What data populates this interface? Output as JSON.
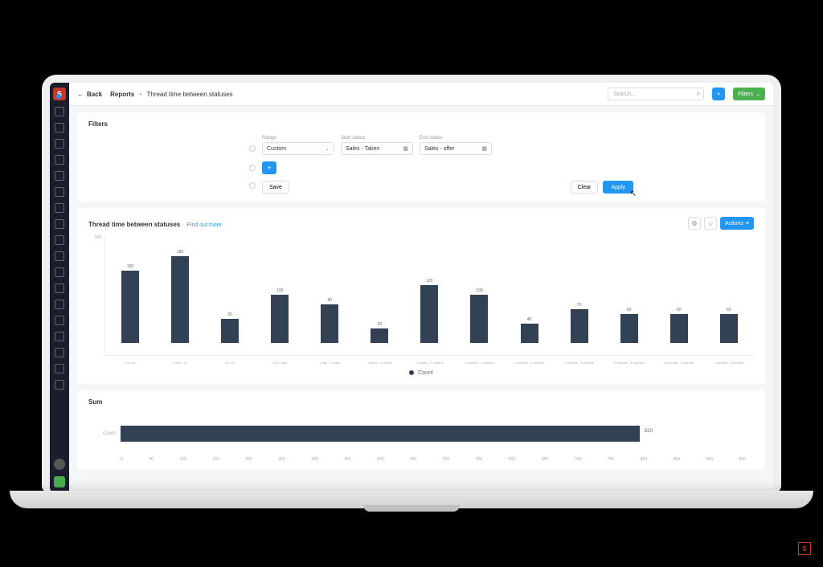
{
  "topbar": {
    "back": "Back",
    "breadcrumb_root": "Reports",
    "breadcrumb_current": "Thread time between statuses",
    "search_placeholder": "Search...",
    "filters_btn": "Filters"
  },
  "filters": {
    "title": "Filters",
    "range_label": "Range",
    "range_value": "Custom",
    "start_label": "Start status",
    "start_value": "Sales - Taken",
    "end_label": "End status",
    "end_value": "Sales - offer",
    "save": "Save",
    "clear": "Clear",
    "apply": "Apply"
  },
  "chart": {
    "title": "Thread time between statuses",
    "find_more": "Find out more",
    "actions": "Actions",
    "legend": "Count"
  },
  "chart_data": {
    "type": "bar",
    "categories": [
      "0-1 min",
      "1 min - 1h",
      "1h-12h",
      "12h-1 day",
      "1 day - 1 week",
      "1 week - 1 month",
      "1 month - 2 months",
      "2 months - 3 months",
      "3 months - 4 months",
      "4 months - 5 months",
      "5 months - 6 months",
      "6 months - 7 months",
      "7 months - 8 months"
    ],
    "values": [
      150,
      180,
      50,
      100,
      80,
      30,
      120,
      100,
      40,
      70,
      60,
      60,
      60
    ],
    "title": "Thread time between statuses",
    "xlabel": "",
    "ylabel": "",
    "ylim": [
      0,
      200
    ],
    "series": [
      {
        "name": "Count",
        "values": [
          150,
          180,
          50,
          100,
          80,
          30,
          120,
          100,
          40,
          70,
          60,
          60,
          60
        ]
      }
    ]
  },
  "sum_panel": {
    "title": "Sum",
    "label": "Count",
    "value": 820,
    "xmax": 1000
  },
  "sum_ticks": [
    "0",
    "50",
    "100",
    "150",
    "200",
    "250",
    "300",
    "350",
    "400",
    "450",
    "500",
    "550",
    "600",
    "650",
    "700",
    "750",
    "800",
    "850",
    "900",
    "950"
  ]
}
